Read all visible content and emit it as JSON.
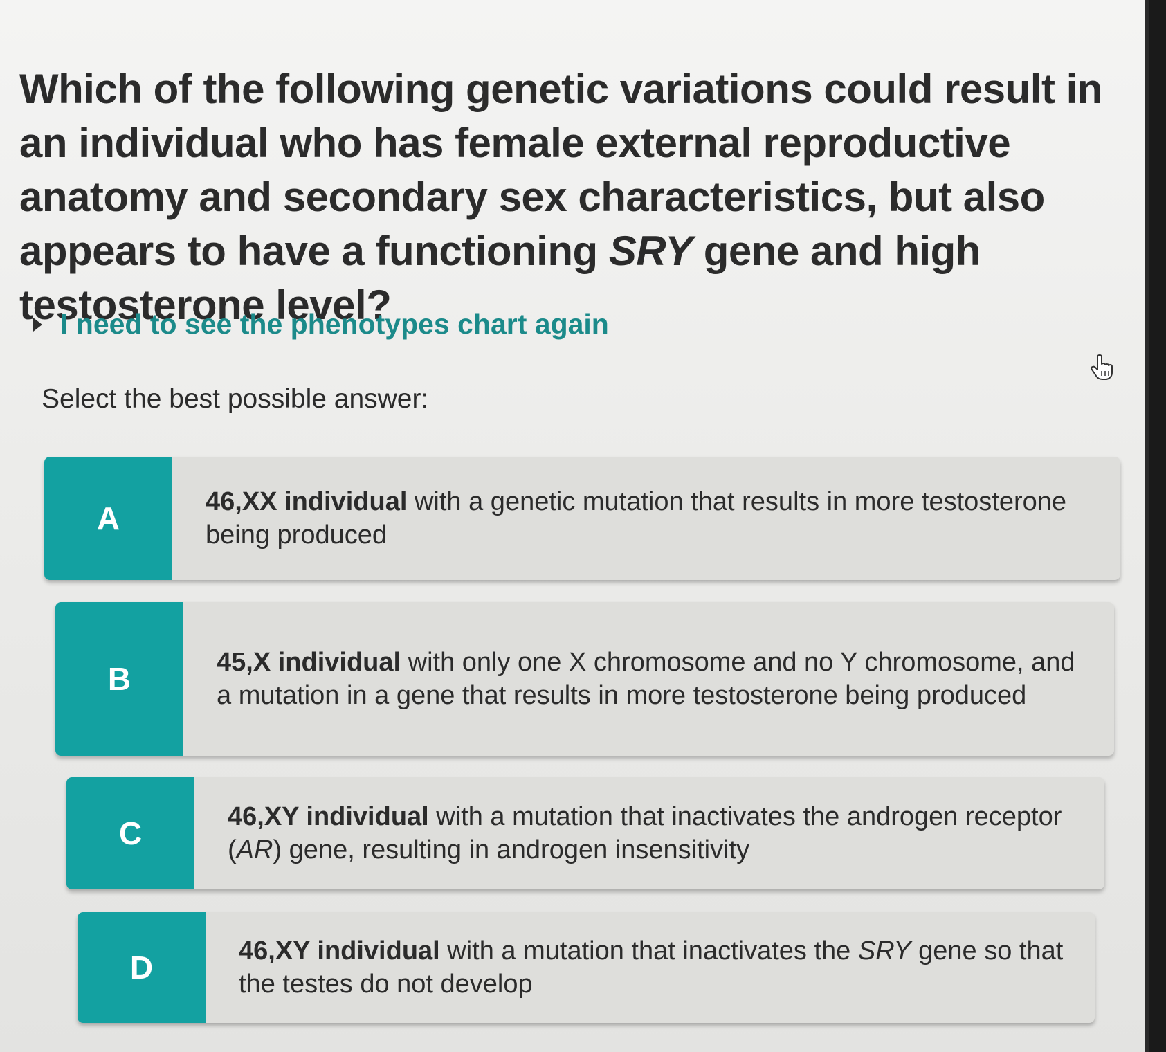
{
  "question": {
    "part1": "Which of the following genetic variations could result in an individual who has female external reproductive anatomy and secondary sex characteristics, but also appears to have a functioning ",
    "gene": "SRY",
    "part2": "gene and high testosterone level?"
  },
  "hint": {
    "label": "I need to see the phenotypes chart again"
  },
  "instruction": "Select the best possible answer:",
  "options": [
    {
      "letter": "A",
      "bold": "46,XX individual",
      "text": " with a genetic mutation that results in more testosterone being produced"
    },
    {
      "letter": "B",
      "bold": "45,X individual",
      "text": " with only one X chromosome and no Y chromosome, and a mutation in a gene that results in more testosterone being produced"
    },
    {
      "letter": "C",
      "bold": "46,XY individual",
      "text": " with a mutation that inactivates the androgen receptor (",
      "italic": "AR",
      "text2": ") gene, resulting in androgen insensitivity"
    },
    {
      "letter": "D",
      "bold": "46,XY individual",
      "text": " with a mutation that inactivates the ",
      "italic": "SRY",
      "text2": "gene so that the testes do not develop"
    }
  ],
  "colors": {
    "accent": "#13a1a1",
    "hint_text": "#1b8a8a",
    "option_bg": "#dededb",
    "text": "#2b2b2b"
  },
  "cursor_icon": "hand-pointer-icon"
}
